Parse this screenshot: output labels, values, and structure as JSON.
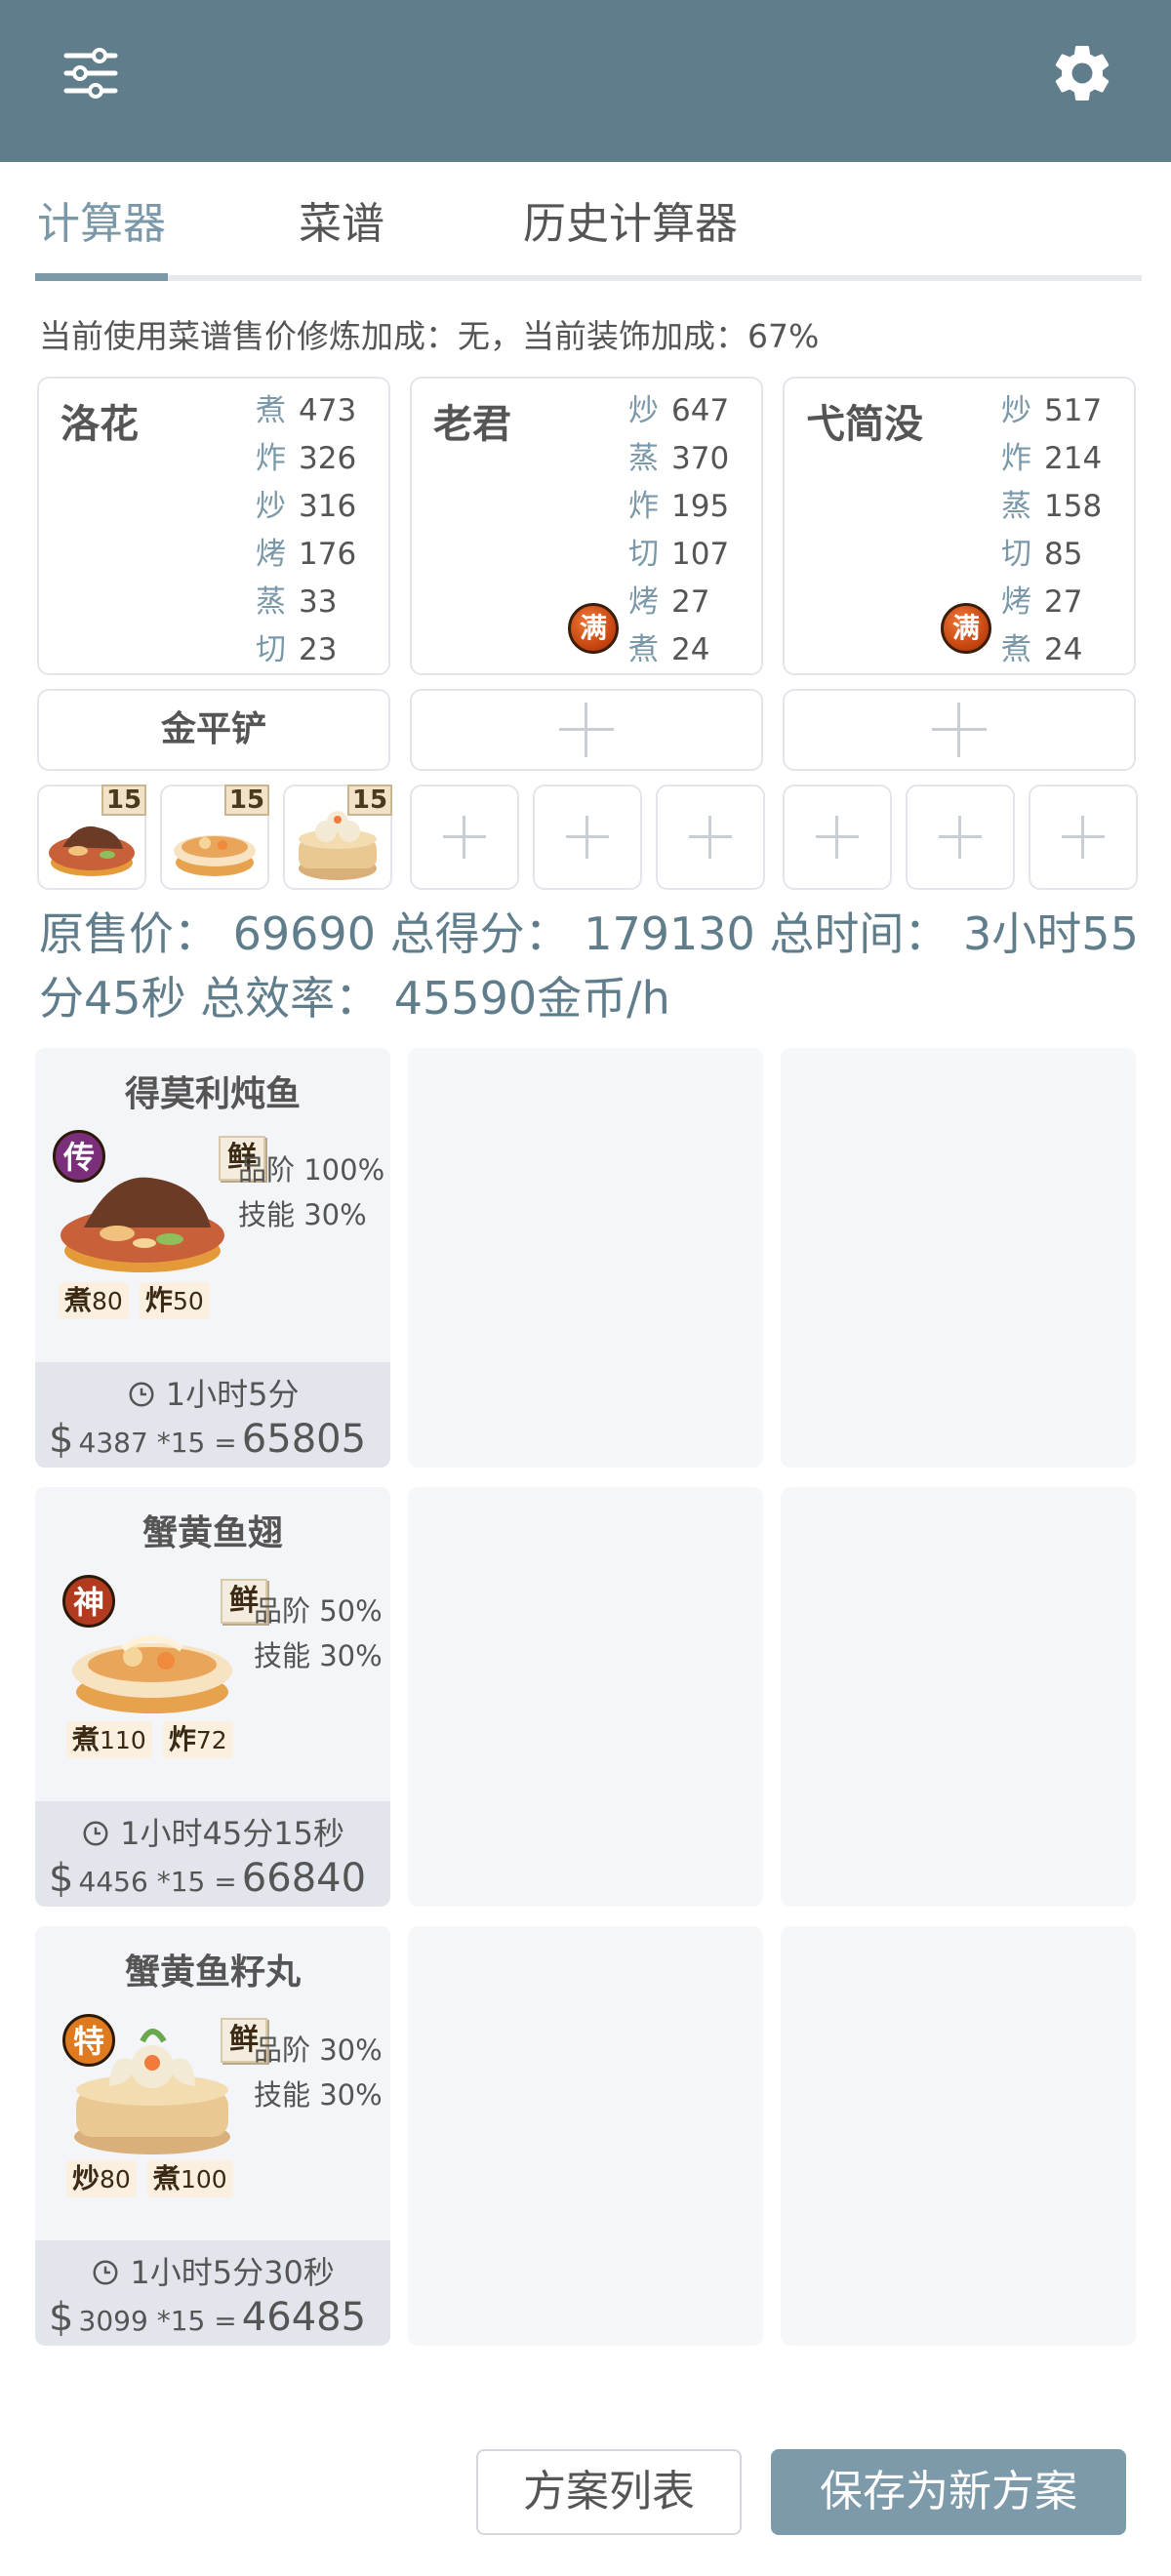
{
  "tabs": [
    {
      "label": "计算器"
    },
    {
      "label": "菜谱"
    },
    {
      "label": "历史计算器"
    }
  ],
  "bonus_line": "当前使用菜谱售价修炼加成：无，当前装饰加成：67%",
  "chefs": [
    {
      "name": "洛花",
      "skills": [
        {
          "k": "煮",
          "v": "473"
        },
        {
          "k": "炸",
          "v": "326"
        },
        {
          "k": "炒",
          "v": "316"
        },
        {
          "k": "烤",
          "v": "176"
        },
        {
          "k": "蒸",
          "v": "33"
        },
        {
          "k": "切",
          "v": "23"
        }
      ],
      "badge": ""
    },
    {
      "name": "老君",
      "skills": [
        {
          "k": "炒",
          "v": "647"
        },
        {
          "k": "蒸",
          "v": "370"
        },
        {
          "k": "炸",
          "v": "195"
        },
        {
          "k": "切",
          "v": "107"
        },
        {
          "k": "烤",
          "v": "27"
        },
        {
          "k": "煮",
          "v": "24"
        }
      ],
      "badge": "满"
    },
    {
      "name": "弋简没",
      "skills": [
        {
          "k": "炒",
          "v": "517"
        },
        {
          "k": "炸",
          "v": "214"
        },
        {
          "k": "蒸",
          "v": "158"
        },
        {
          "k": "切",
          "v": "85"
        },
        {
          "k": "烤",
          "v": "27"
        },
        {
          "k": "煮",
          "v": "24"
        }
      ],
      "badge": "满"
    }
  ],
  "equipment": {
    "slot1": "金平铲"
  },
  "dish_slots": [
    {
      "qty": "15"
    },
    {
      "qty": "15"
    },
    {
      "qty": "15"
    }
  ],
  "summary": "原售价： 69690 总得分： 179130 总时间： 3小时55分45秒 总效率： 45590金币/h",
  "recipes": [
    {
      "title": "得莫利炖鱼",
      "rarity": "传",
      "rarity_color": "#7b2f7a",
      "flavor": "鲜",
      "rank": "品阶 100%",
      "skill": "技能 30%",
      "req": [
        {
          "k": "煮",
          "v": "80"
        },
        {
          "k": "炸",
          "v": "50"
        }
      ],
      "time": "1小时5分",
      "cur": "$",
      "calc": "4387 *15  =",
      "total": "65805"
    },
    {
      "title": "蟹黄鱼翅",
      "rarity": "神",
      "rarity_color": "#b23a1e",
      "flavor": "鲜",
      "rank": "品阶 50%",
      "skill": "技能 30%",
      "req": [
        {
          "k": "煮",
          "v": "110"
        },
        {
          "k": "炸",
          "v": "72"
        }
      ],
      "time": "1小时45分15秒",
      "cur": "$",
      "calc": "4456 *15  =",
      "total": "66840"
    },
    {
      "title": "蟹黄鱼籽丸",
      "rarity": "特",
      "rarity_color": "#e07a1f",
      "flavor": "鲜",
      "rank": "品阶 30%",
      "skill": "技能 30%",
      "req": [
        {
          "k": "炒",
          "v": "80"
        },
        {
          "k": "煮",
          "v": "100"
        }
      ],
      "time": "1小时5分30秒",
      "cur": "$",
      "calc": "3099 *15  =",
      "total": "46485"
    }
  ],
  "buttons": {
    "plan_list": "方案列表",
    "save_new": "保存为新方案"
  },
  "colors": {
    "header": "#607d8b",
    "accent": "#7a98a8"
  }
}
